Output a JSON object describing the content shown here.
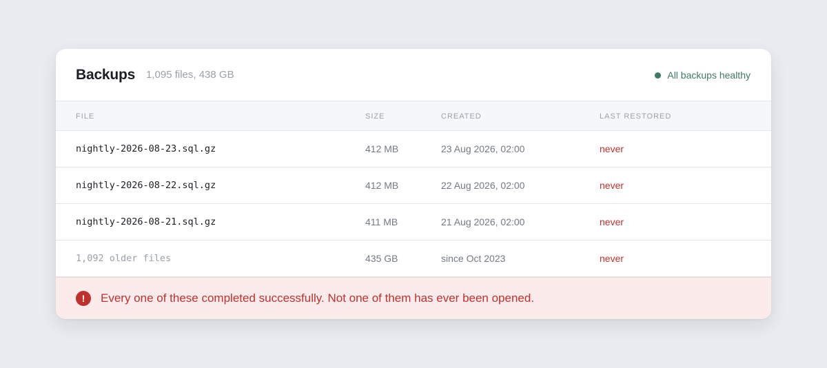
{
  "header": {
    "title": "Backups",
    "summary": "1,095 files, 438 GB",
    "status": "All backups healthy"
  },
  "table": {
    "columns": [
      "FILE",
      "SIZE",
      "CREATED",
      "LAST RESTORED"
    ],
    "rows": [
      {
        "file": "nightly-2026-08-23.sql.gz",
        "size": "412 MB",
        "created": "23 Aug 2026, 02:00",
        "last_restored": "never"
      },
      {
        "file": "nightly-2026-08-22.sql.gz",
        "size": "412 MB",
        "created": "22 Aug 2026, 02:00",
        "last_restored": "never"
      },
      {
        "file": "nightly-2026-08-21.sql.gz",
        "size": "411 MB",
        "created": "21 Aug 2026, 02:00",
        "last_restored": "never"
      },
      {
        "file": "1,092 older files",
        "size": "435 GB",
        "created": "since Oct 2023",
        "last_restored": "never"
      }
    ]
  },
  "banner": {
    "icon": "alert-icon",
    "icon_glyph": "!",
    "message": "Every one of these completed successfully. Not one of them has ever been opened."
  },
  "colors": {
    "healthy": "#3f7a62",
    "danger": "#c0302c",
    "banner_bg": "#fbeceb"
  }
}
